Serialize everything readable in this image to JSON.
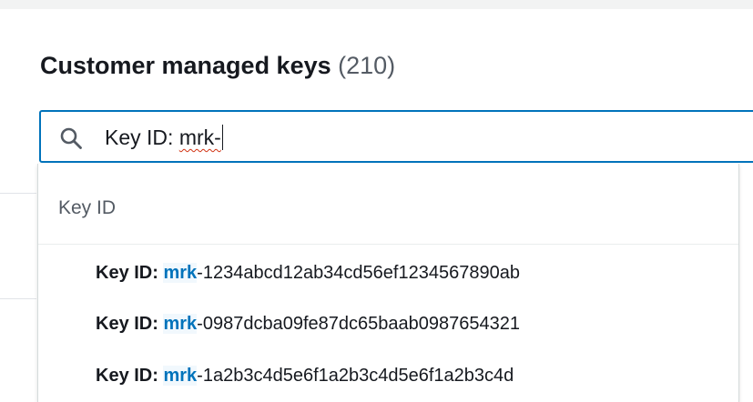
{
  "header": {
    "title": "Customer managed keys",
    "count": "(210)"
  },
  "search": {
    "icon": "search-icon",
    "value_prefix": "Key ID: ",
    "value_typed": "mrk-"
  },
  "dropdown": {
    "group_label": "Key ID",
    "options": [
      {
        "label": "Key ID:",
        "match": "mrk",
        "rest": "-1234abcd12ab34cd56ef1234567890ab"
      },
      {
        "label": "Key ID:",
        "match": "mrk",
        "rest": "-0987dcba09fe87dc65baab0987654321"
      },
      {
        "label": "Key ID:",
        "match": "mrk",
        "rest": "-1a2b3c4d5e6f1a2b3c4d5e6f1a2b3c4d"
      }
    ]
  },
  "colors": {
    "accent": "#0073bb",
    "match_highlight_bg": "#f1f8fd",
    "text_primary": "#16191f",
    "text_secondary": "#545b64",
    "spellcheck": "#d13212"
  }
}
